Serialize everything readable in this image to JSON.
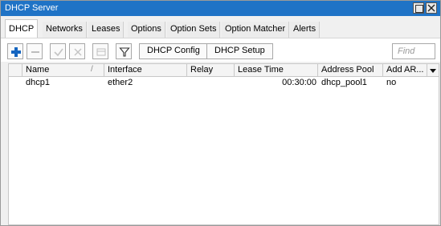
{
  "window": {
    "title": "DHCP Server"
  },
  "tabs": [
    "DHCP",
    "Networks",
    "Leases",
    "Options",
    "Option Sets",
    "Option Matcher",
    "Alerts"
  ],
  "toolbar": {
    "dhcp_config_label": "DHCP Config",
    "dhcp_setup_label": "DHCP Setup",
    "find_placeholder": "Find"
  },
  "table": {
    "columns": [
      "Name",
      "Interface",
      "Relay",
      "Lease Time",
      "Address Pool",
      "Add AR..."
    ],
    "sort_indicator": "/",
    "rows": [
      {
        "name": "dhcp1",
        "interface": "ether2",
        "relay": "",
        "lease_time": "00:30:00",
        "address_pool": "dhcp_pool1",
        "add_arp": "no"
      }
    ]
  },
  "colors": {
    "titlebar": "#1f73c6",
    "add_icon": "#1565c0"
  }
}
